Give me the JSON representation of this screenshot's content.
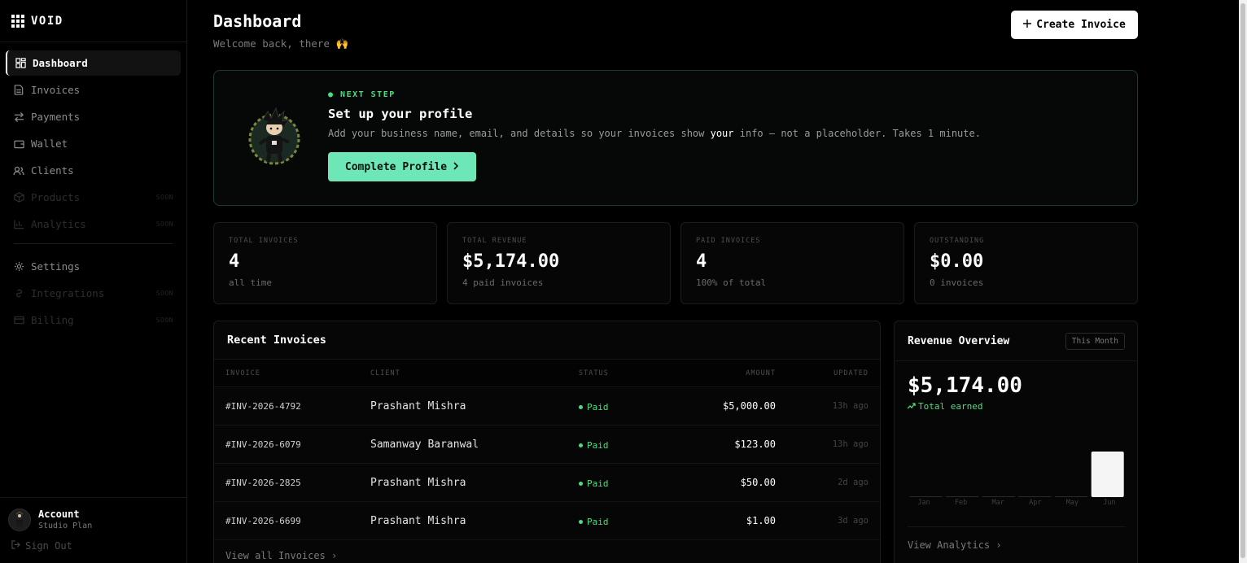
{
  "brand": {
    "name": "VOID"
  },
  "sidebar": {
    "items": [
      {
        "label": "Dashboard",
        "icon": "dashboard-icon",
        "state": "active"
      },
      {
        "label": "Invoices",
        "icon": "document-icon",
        "state": "normal"
      },
      {
        "label": "Payments",
        "icon": "arrows-icon",
        "state": "normal"
      },
      {
        "label": "Wallet",
        "icon": "wallet-icon",
        "state": "normal"
      },
      {
        "label": "Clients",
        "icon": "users-icon",
        "state": "normal"
      },
      {
        "label": "Products",
        "icon": "box-icon",
        "state": "disabled",
        "tag": "SOON"
      },
      {
        "label": "Analytics",
        "icon": "bar-chart-icon",
        "state": "disabled",
        "tag": "SOON"
      }
    ],
    "items2": [
      {
        "label": "Settings",
        "icon": "gear-icon",
        "state": "normal"
      },
      {
        "label": "Integrations",
        "icon": "link-icon",
        "state": "disabled",
        "tag": "SOON"
      },
      {
        "label": "Billing",
        "icon": "card-icon",
        "state": "disabled",
        "tag": "SOON"
      }
    ],
    "account": {
      "name": "Account",
      "plan": "Studio Plan",
      "signout": "Sign Out"
    }
  },
  "header": {
    "title": "Dashboard",
    "subtitle": "Welcome back, there 🙌",
    "create_label": "Create Invoice"
  },
  "next_step": {
    "kicker": "NEXT STEP",
    "title": "Set up your profile",
    "desc_before": "Add your business name, email, and details so your invoices show ",
    "desc_bold": "your",
    "desc_after": " info — not a placeholder. Takes 1 minute.",
    "button": "Complete Profile"
  },
  "stats": [
    {
      "label": "TOTAL INVOICES",
      "value": "4",
      "sub": "all time"
    },
    {
      "label": "TOTAL REVENUE",
      "value": "$5,174.00",
      "sub": "4 paid invoices"
    },
    {
      "label": "PAID INVOICES",
      "value": "4",
      "sub": "100% of total"
    },
    {
      "label": "OUTSTANDING",
      "value": "$0.00",
      "sub": "0 invoices"
    }
  ],
  "recent": {
    "title": "Recent Invoices",
    "columns": [
      "INVOICE",
      "CLIENT",
      "STATUS",
      "AMOUNT",
      "UPDATED"
    ],
    "rows": [
      {
        "invoice": "#INV-2026-4792",
        "client": "Prashant Mishra",
        "status": "Paid",
        "amount": "$5,000.00",
        "updated": "13h ago"
      },
      {
        "invoice": "#INV-2026-6079",
        "client": "Samanway Baranwal",
        "status": "Paid",
        "amount": "$123.00",
        "updated": "13h ago"
      },
      {
        "invoice": "#INV-2026-2825",
        "client": "Prashant Mishra",
        "status": "Paid",
        "amount": "$50.00",
        "updated": "2d ago"
      },
      {
        "invoice": "#INV-2026-6699",
        "client": "Prashant Mishra",
        "status": "Paid",
        "amount": "$1.00",
        "updated": "3d ago"
      }
    ],
    "view_all": "View all Invoices"
  },
  "revenue": {
    "title": "Revenue Overview",
    "period": "This Month",
    "amount": "$5,174.00",
    "earned_label": "Total earned",
    "link": "View Analytics"
  },
  "colors": {
    "accent": "#6ee7b7",
    "success": "#4ade80",
    "background": "#000000"
  },
  "chart_data": {
    "type": "bar",
    "categories": [
      "Jan",
      "Feb",
      "Mar",
      "Apr",
      "May",
      "Jun"
    ],
    "values": [
      0,
      0,
      0,
      0,
      0,
      5174
    ],
    "title": "Revenue Overview",
    "xlabel": "",
    "ylabel": "",
    "grid": false
  }
}
